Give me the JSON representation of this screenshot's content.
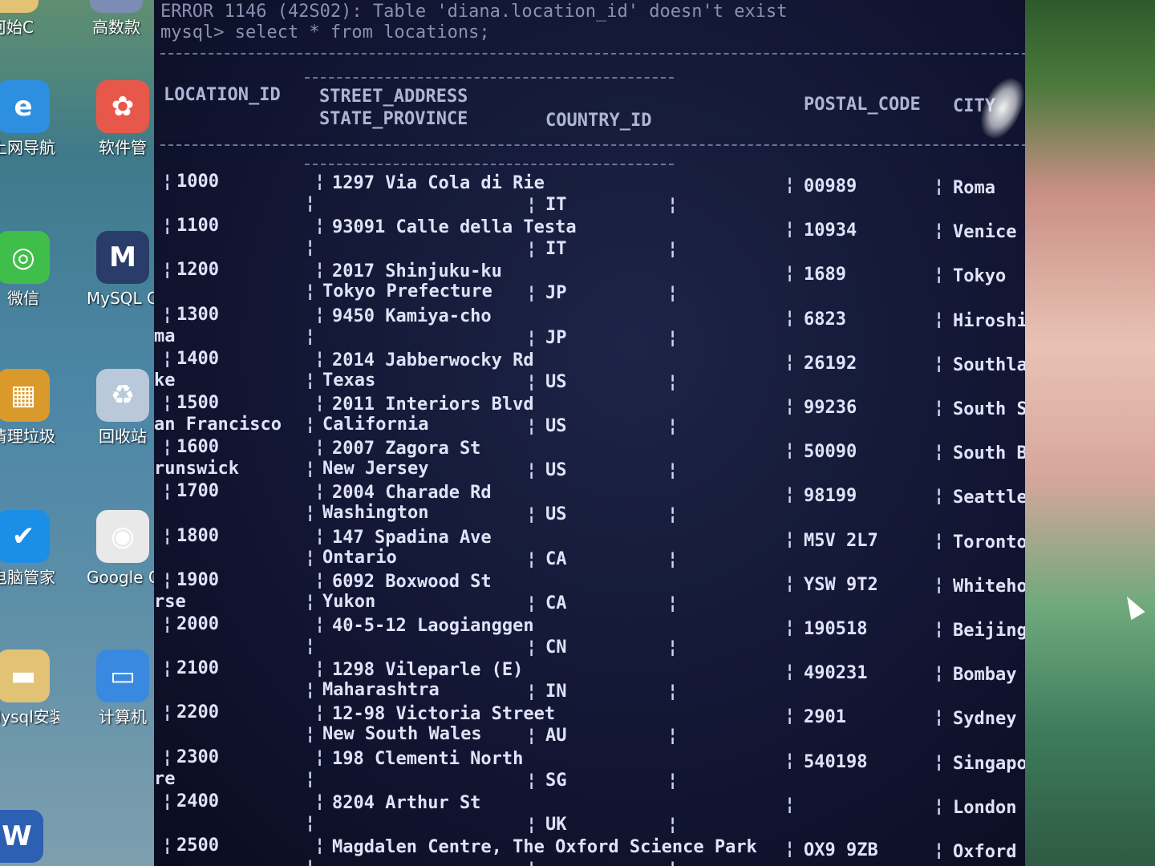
{
  "desktop": {
    "icons": [
      {
        "label": "河始C",
        "icon": "folder-icon"
      },
      {
        "label": "高数款",
        "icon": "app-icon"
      },
      {
        "label": "上网导航",
        "icon": "ie-browser-icon"
      },
      {
        "label": "软件管",
        "icon": "software-manager-icon"
      },
      {
        "label": "微信",
        "icon": "wechat-icon"
      },
      {
        "label": "MySQL Comma",
        "icon": "mysql-icon"
      },
      {
        "label": "清理垃圾",
        "icon": "cleanup-icon"
      },
      {
        "label": "回收站",
        "icon": "recycle-bin-icon"
      },
      {
        "label": "电脑管家",
        "icon": "pc-manager-icon"
      },
      {
        "label": "Google Chrome",
        "icon": "chrome-icon"
      },
      {
        "label": "Mysql安装",
        "icon": "folder-icon"
      },
      {
        "label": "计算机",
        "icon": "computer-icon"
      },
      {
        "label": "W",
        "icon": "word-icon"
      }
    ]
  },
  "terminal": {
    "error_line": "ERROR 1146 (42S02): Table 'diana.location_id' doesn't exist",
    "prompt": "mysql> select * from locations;",
    "headers": {
      "location_id": "LOCATION_ID",
      "street_address": "STREET_ADDRESS",
      "postal_code": "POSTAL_CODE",
      "city": "CITY",
      "state_province": "STATE_PROVINCE",
      "country_id": "COUNTRY_ID"
    },
    "rows": [
      {
        "id": "1000",
        "street": "1297 Via Cola di Rie",
        "postal": "00989",
        "city": "Roma",
        "wrap": "",
        "state": "",
        "country": "IT"
      },
      {
        "id": "1100",
        "street": "93091 Calle della Testa",
        "postal": "10934",
        "city": "Venice",
        "wrap": "",
        "state": "",
        "country": "IT"
      },
      {
        "id": "1200",
        "street": "2017 Shinjuku-ku",
        "postal": "1689",
        "city": "Tokyo",
        "wrap": "",
        "state": "Tokyo Prefecture",
        "country": "JP"
      },
      {
        "id": "1300",
        "street": "9450 Kamiya-cho",
        "postal": "6823",
        "city": "Hiroshi",
        "wrap": "ma",
        "state": "",
        "country": "JP"
      },
      {
        "id": "1400",
        "street": "2014 Jabberwocky Rd",
        "postal": "26192",
        "city": "Southla",
        "wrap": "ke",
        "state": "Texas",
        "country": "US"
      },
      {
        "id": "1500",
        "street": "2011 Interiors Blvd",
        "postal": "99236",
        "city": "South S",
        "wrap": "an Francisco",
        "state": "California",
        "country": "US"
      },
      {
        "id": "1600",
        "street": "2007 Zagora St",
        "postal": "50090",
        "city": "South B",
        "wrap": "runswick",
        "state": "New Jersey",
        "country": "US"
      },
      {
        "id": "1700",
        "street": "2004 Charade Rd",
        "postal": "98199",
        "city": "Seattle",
        "wrap": "",
        "state": "Washington",
        "country": "US"
      },
      {
        "id": "1800",
        "street": "147 Spadina Ave",
        "postal": "M5V 2L7",
        "city": "Toronto",
        "wrap": "",
        "state": "Ontario",
        "country": "CA"
      },
      {
        "id": "1900",
        "street": "6092 Boxwood St",
        "postal": "YSW 9T2",
        "city": "Whiteho",
        "wrap": "rse",
        "state": "Yukon",
        "country": "CA"
      },
      {
        "id": "2000",
        "street": "40-5-12 Laogianggen",
        "postal": "190518",
        "city": "Beijing",
        "wrap": "",
        "state": "",
        "country": "CN"
      },
      {
        "id": "2100",
        "street": "1298 Vileparle (E)",
        "postal": "490231",
        "city": "Bombay",
        "wrap": "",
        "state": "Maharashtra",
        "country": "IN"
      },
      {
        "id": "2200",
        "street": "12-98 Victoria Street",
        "postal": "2901",
        "city": "Sydney",
        "wrap": "",
        "state": "New South Wales",
        "country": "AU"
      },
      {
        "id": "2300",
        "street": "198 Clementi North",
        "postal": "540198",
        "city": "Singapo",
        "wrap": "re",
        "state": "",
        "country": "SG"
      },
      {
        "id": "2400",
        "street": "8204 Arthur St",
        "postal": "",
        "city": "London",
        "wrap": "",
        "state": "",
        "country": "UK"
      },
      {
        "id": "2500",
        "street": "Magdalen Centre, The Oxford Science Park",
        "postal": "OX9 9ZB",
        "city": "Oxford",
        "wrap": "",
        "state": "",
        "country": ""
      }
    ]
  }
}
